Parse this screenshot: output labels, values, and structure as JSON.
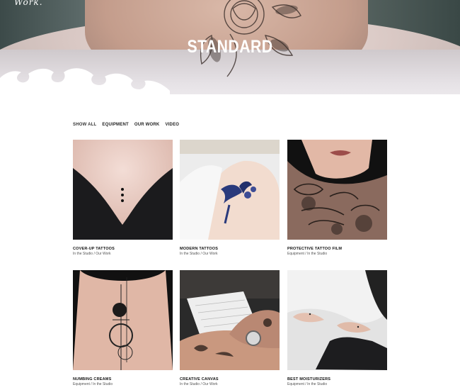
{
  "hero": {
    "logo": "Work.",
    "title": "STANDARD"
  },
  "filters": [
    {
      "label": "SHOW ALL",
      "active": true
    },
    {
      "label": "EQUIPMENT",
      "active": false
    },
    {
      "label": "OUR WORK",
      "active": false
    },
    {
      "label": "VIDEO",
      "active": false
    }
  ],
  "portfolio": [
    {
      "name": "COVER-UP TATTOOS",
      "categories": "In the Studio / Our Work",
      "image": "back-dots-tattoo"
    },
    {
      "name": "MODERN TATTOOS",
      "categories": "In the Studio / Our Work",
      "image": "shoulder-bird-tattoo"
    },
    {
      "name": "PROTECTIVE TATTOO FILM",
      "categories": "Equipment / In the Studio",
      "image": "neck-tattoo-portrait"
    },
    {
      "name": "NUMBING CREAMS",
      "categories": "Equipment / In the Studio",
      "image": "spine-circles-tattoo"
    },
    {
      "name": "CREATIVE CANVAS",
      "categories": "In the Studio / Our Work",
      "image": "tattooed-arms-notebook"
    },
    {
      "name": "BEST MOISTURIZERS",
      "categories": "Equipment / In the Studio",
      "image": "ankle-tattoo-feet"
    }
  ]
}
